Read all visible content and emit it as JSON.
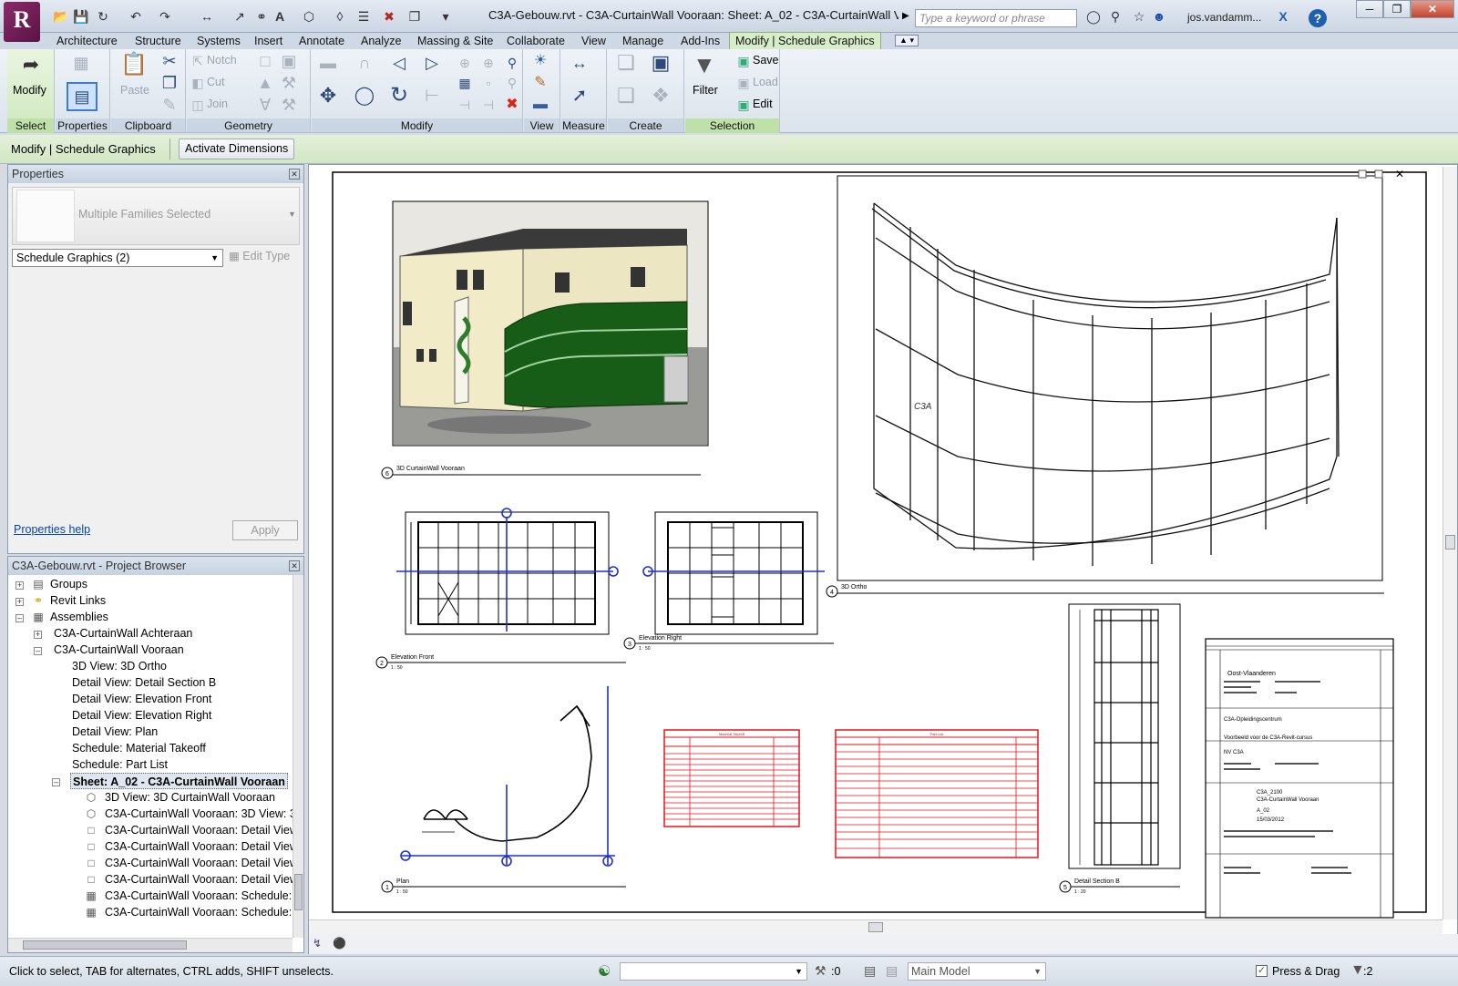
{
  "app": {
    "logo_letter": "R",
    "window_title": "C3A-Gebouw.rvt - C3A-CurtainWall Vooraan: Sheet: A_02 - C3A-CurtainWall Vooraan",
    "search_placeholder": "Type a keyword or phrase",
    "username": "jos.vandamm...",
    "help": "?"
  },
  "tabs": [
    "Architecture",
    "Structure",
    "Systems",
    "Insert",
    "Annotate",
    "Analyze",
    "Massing & Site",
    "Collaborate",
    "View",
    "Manage",
    "Add-Ins",
    "Modify | Schedule Graphics"
  ],
  "ribbon": {
    "modify": "Modify",
    "paste": "Paste",
    "notch": "Notch",
    "cut": "Cut",
    "join": "Join",
    "filter": "Filter",
    "save": "Save",
    "load": "Load",
    "edit": "Edit",
    "panels": {
      "select": "Select",
      "properties": "Properties",
      "clipboard": "Clipboard",
      "geometry": "Geometry",
      "modify": "Modify",
      "view": "View",
      "measure": "Measure",
      "create": "Create",
      "selection": "Selection"
    }
  },
  "options_bar": {
    "context": "Modify | Schedule Graphics",
    "activate_dimensions": "Activate Dimensions"
  },
  "properties": {
    "title": "Properties",
    "type_name": "Multiple Families Selected",
    "selector": "Schedule Graphics (2)",
    "edit_type": "Edit Type",
    "help_link": "Properties help",
    "apply": "Apply"
  },
  "browser": {
    "title": "C3A-Gebouw.rvt - Project Browser",
    "items": [
      {
        "label": "Groups"
      },
      {
        "label": "Revit Links"
      },
      {
        "label": "Assemblies"
      },
      {
        "label": "C3A-CurtainWall Achteraan"
      },
      {
        "label": "C3A-CurtainWall Vooraan"
      },
      {
        "label": "3D View: 3D Ortho"
      },
      {
        "label": "Detail View: Detail Section B"
      },
      {
        "label": "Detail View: Elevation Front"
      },
      {
        "label": "Detail View: Elevation Right"
      },
      {
        "label": "Detail View: Plan"
      },
      {
        "label": "Schedule: Material Takeoff"
      },
      {
        "label": "Schedule: Part List"
      },
      {
        "label": "Sheet: A_02 - C3A-CurtainWall Vooraan"
      },
      {
        "label": "3D View: 3D CurtainWall Vooraan"
      },
      {
        "label": "C3A-CurtainWall Vooraan: 3D View: 3D"
      },
      {
        "label": "C3A-CurtainWall Vooraan: Detail View:"
      },
      {
        "label": "C3A-CurtainWall Vooraan: Detail View:"
      },
      {
        "label": "C3A-CurtainWall Vooraan: Detail View:"
      },
      {
        "label": "C3A-CurtainWall Vooraan: Detail View:"
      },
      {
        "label": "C3A-CurtainWall Vooraan: Schedule: M"
      },
      {
        "label": "C3A-CurtainWall Vooraan: Schedule: P"
      }
    ]
  },
  "sheet": {
    "views": {
      "v6_num": "6",
      "v6_title": "3D CurtainWall Vooraan",
      "v4_num": "4",
      "v4_title": "3D Ortho",
      "v2_num": "2",
      "v2_title": "Elevation Front",
      "v2_scale": "1 : 50",
      "v3_num": "3",
      "v3_title": "Elevation Right",
      "v3_scale": "1 : 50",
      "v1_num": "1",
      "v1_title": "Plan",
      "v1_scale": "1 : 50",
      "v5_num": "5",
      "v5_title": "Detail Section B",
      "v5_scale": "1 : 20"
    },
    "schedule_takeoff_header": "Material Takeoff",
    "schedule_partlist_header": "Part List",
    "title_block": {
      "org": "Oost-Vlaanderen",
      "client": "C3A-Opleidingscentrum",
      "project": "Voorbeeld voor de C3A-Revit-cursus",
      "ref": "C3A_2100",
      "sheet_no": "A_02",
      "date": "15/03/2012",
      "plan": "C3A-CurtainWall Vooraan",
      "owner": "NV C3A"
    }
  },
  "status": {
    "hint": "Click to select, TAB for alternates, CTRL adds, SHIFT unselects.",
    "model": "Main Model",
    "count0": ":0",
    "press_drag": "Press & Drag",
    "filter_count": ":2"
  },
  "colors": {
    "ribbon_context": "#d7ecc9",
    "schedule_red": "#e5141b",
    "dimension_blue": "#1d2fd8"
  }
}
